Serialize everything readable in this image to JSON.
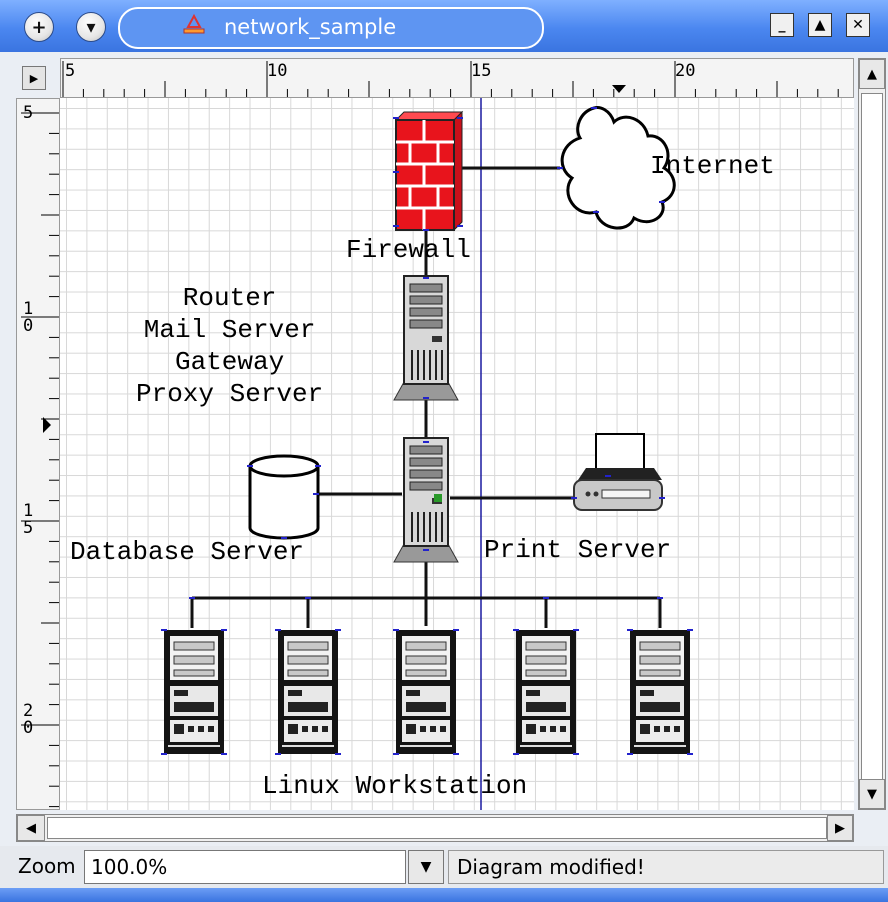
{
  "window": {
    "title": "network_sample",
    "menu_button_icon": "plus-icon",
    "shade_button_icon": "chevron-down-icon",
    "minimize_label": "_",
    "maximize_label": "▲",
    "close_label": "✕"
  },
  "rulers": {
    "horizontal_labels": [
      "5",
      "10",
      "15",
      "20"
    ],
    "vertical_labels": [
      "5",
      "1\n0",
      "1\n5",
      "2\n0"
    ]
  },
  "diagram": {
    "labels": {
      "internet": "Internet",
      "firewall": "Firewall",
      "router": "Router\nMail Server\nGateway\nProxy Server",
      "database": "Database Server",
      "print": "Print Server",
      "workstation": "Linux Workstation"
    }
  },
  "status": {
    "zoom_label": "Zoom",
    "zoom_value": "100.0%",
    "message": "Diagram modified!"
  },
  "colors": {
    "titlebar": "#4b87f0",
    "firewall": "#e8141c",
    "guide_line": "#1a1aa0",
    "handle": "#2222cc"
  }
}
